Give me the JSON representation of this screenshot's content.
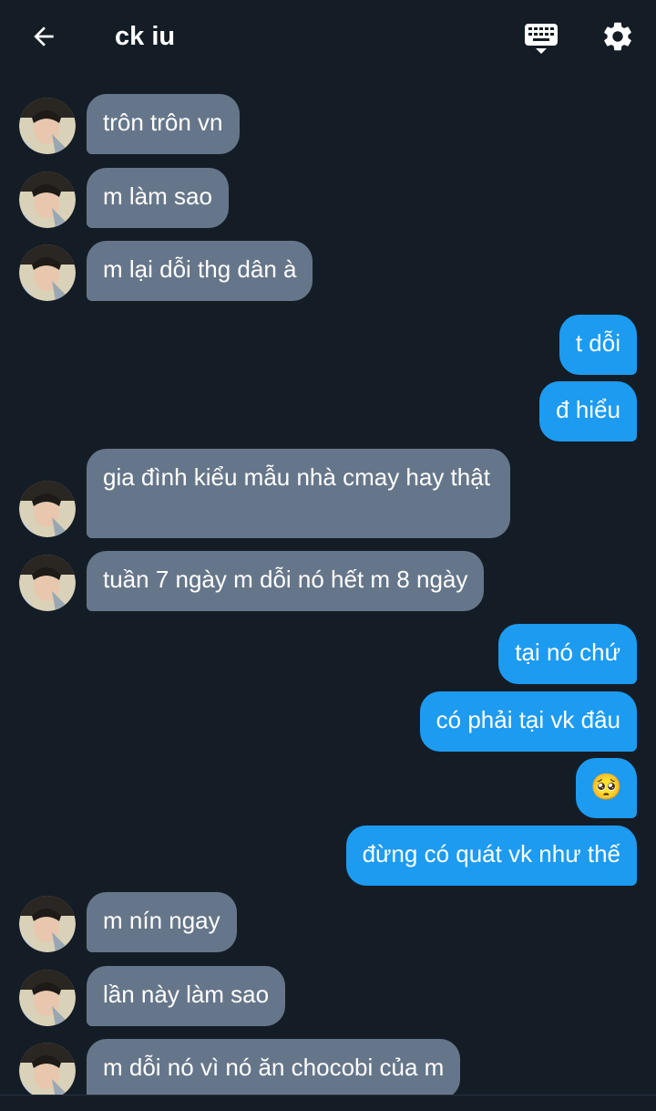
{
  "header": {
    "title": "ck iu",
    "back_icon": "arrow-left-icon",
    "keyboard_icon": "keyboard-icon",
    "settings_icon": "gear-icon"
  },
  "colors": {
    "background": "#141d26",
    "incoming_bubble": "#66768a",
    "outgoing_bubble": "#1d9bf0",
    "text": "#ffffff"
  },
  "messages": [
    {
      "side": "in",
      "text": "trôn trôn vn"
    },
    {
      "side": "in",
      "text": "m làm sao"
    },
    {
      "side": "in",
      "text": "m lại dỗi thg dân à"
    },
    {
      "side": "out",
      "text": "t dỗi"
    },
    {
      "side": "out",
      "text": "đ hiểu"
    },
    {
      "side": "in",
      "text": "gia đình kiểu mẫu nhà cmay hay thật"
    },
    {
      "side": "in",
      "text": "tuần 7 ngày m dỗi nó hết m 8 ngày"
    },
    {
      "side": "out",
      "text": "tại nó chứ"
    },
    {
      "side": "out",
      "text": "có phải tại vk đâu"
    },
    {
      "side": "out",
      "text": "🥺"
    },
    {
      "side": "out",
      "text": "đừng có quát vk như thế"
    },
    {
      "side": "in",
      "text": "m nín ngay"
    },
    {
      "side": "in",
      "text": "lần này làm sao"
    },
    {
      "side": "in",
      "text": "m dỗi nó vì nó ăn chocobi của m"
    }
  ]
}
